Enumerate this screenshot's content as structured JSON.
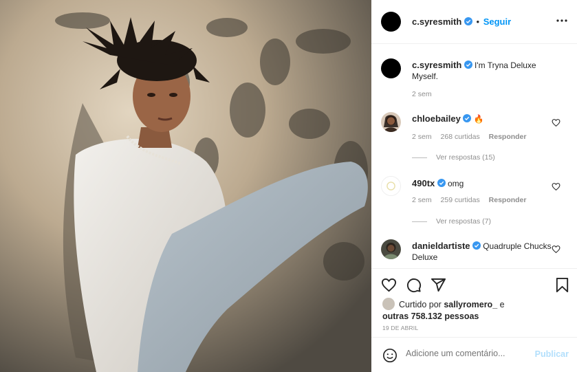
{
  "post": {
    "author": "c.syresmith",
    "follow_label": "Seguir",
    "dot": "•"
  },
  "caption": {
    "author": "c.syresmith",
    "text": "I'm Tryna Deluxe Myself.",
    "time": "2 sem"
  },
  "comments": [
    {
      "author": "chloebailey",
      "text": "🔥",
      "time": "2 sem",
      "likes": "268 curtidas",
      "reply_label": "Responder",
      "view_replies": "Ver respostas (15)"
    },
    {
      "author": "490tx",
      "text": "omg",
      "time": "2 sem",
      "likes": "259 curtidas",
      "reply_label": "Responder",
      "view_replies": "Ver respostas (7)"
    },
    {
      "author": "danieldartiste",
      "text": "Quadruple Chucks Deluxe"
    }
  ],
  "likes": {
    "prefix": "Curtido por",
    "user": "sallyromero_",
    "connector": "e",
    "others": "outras 758.132 pessoas"
  },
  "date": "19 DE ABRIL",
  "add_comment": {
    "placeholder": "Adicione um comentário...",
    "publish_label": "Publicar"
  },
  "colors": {
    "link_blue": "#0095f6",
    "verified_blue": "#3897f0",
    "muted": "#8e8e8e",
    "publish_disabled": "#b2dffc"
  }
}
